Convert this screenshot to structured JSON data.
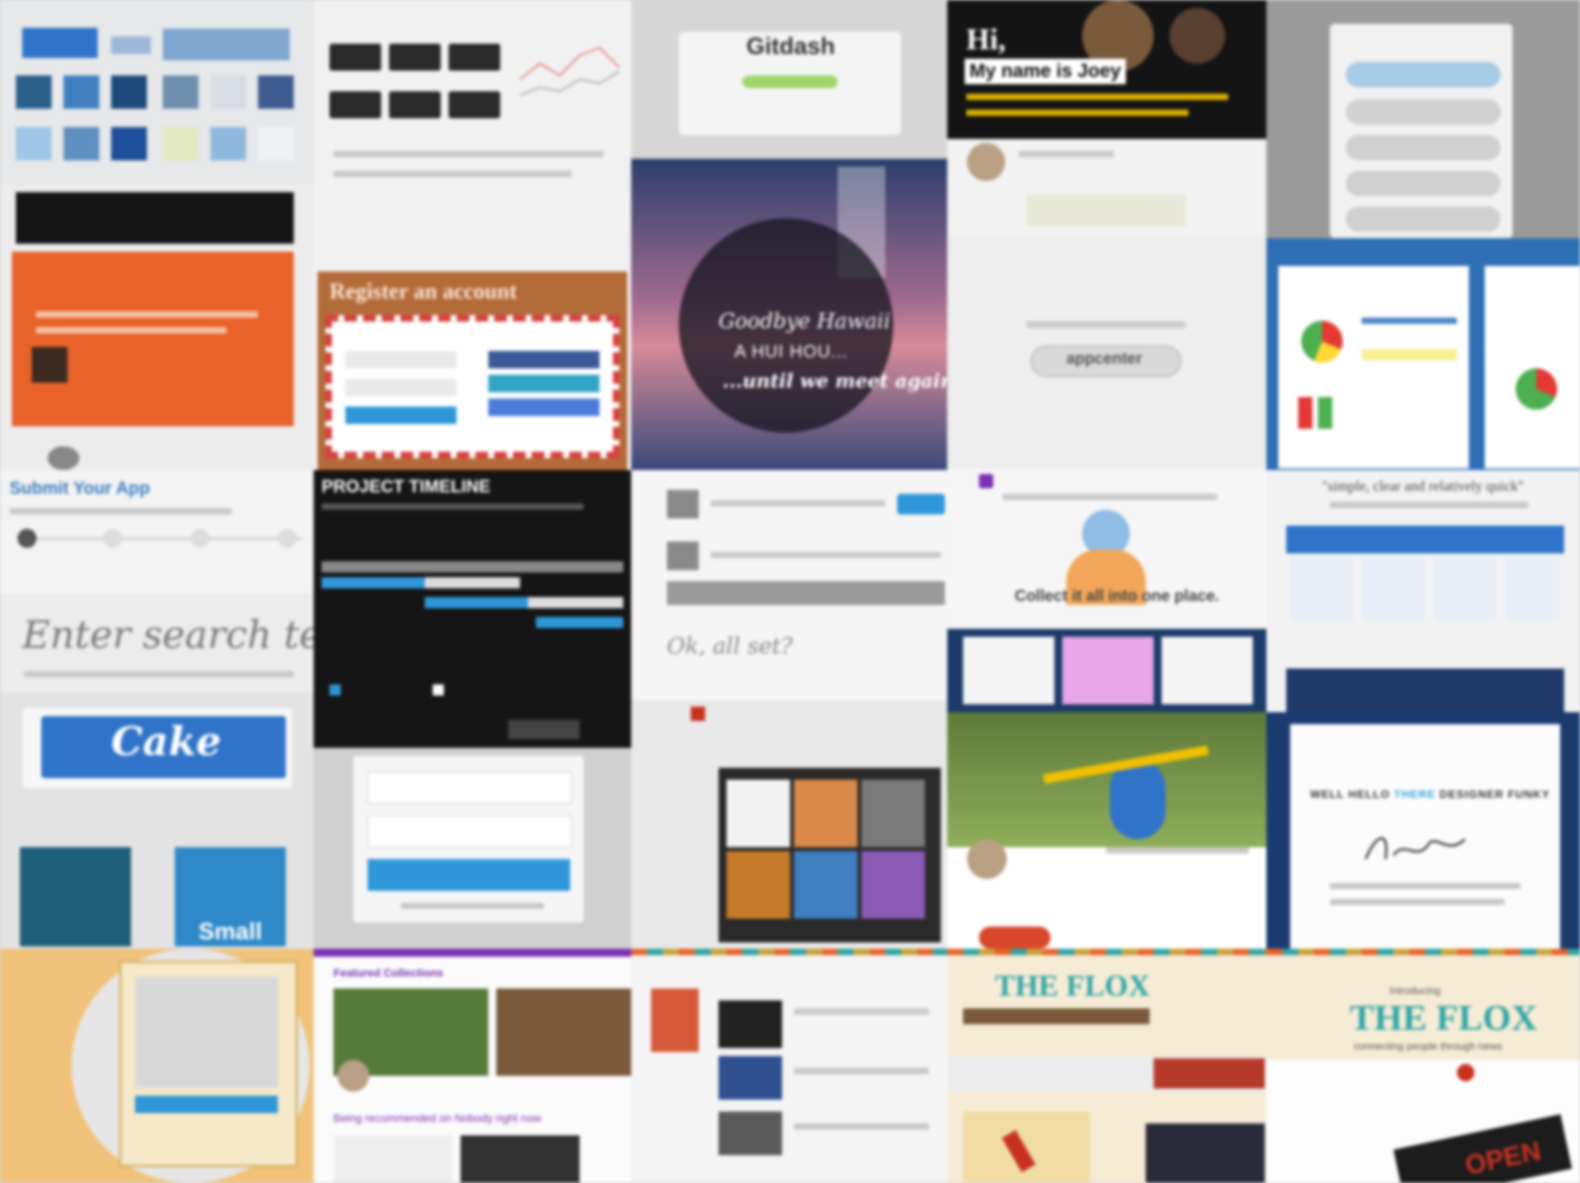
{
  "collage": {
    "gitdash": {
      "logo_text": "Gitdash"
    },
    "joey": {
      "greeting": "Hi,",
      "name_line": "My name is Joey"
    },
    "register": {
      "title": "Register an account"
    },
    "goodbye": {
      "line1": "Goodbye Hawaii",
      "line2": "A HUI HOU...",
      "line3": "...until we meet again"
    },
    "appcenter": {
      "button_label": "appcenter"
    },
    "submit_app": {
      "title": "Submit Your App"
    },
    "timeline": {
      "title": "PROJECT TIMELINE"
    },
    "collect": {
      "tagline": "Collect it all into one place."
    },
    "search": {
      "placeholder": "Enter search term"
    },
    "allset": {
      "heading": "Ok, all set?"
    },
    "cake": {
      "logo_text": "Cake",
      "small_label": "Small"
    },
    "simple": {
      "quote": "\"simple, clear and relatively quick\""
    },
    "designer": {
      "heading_pre": "WELL HELLO ",
      "heading_em": "THERE",
      "heading_post": " DESIGNER FUNKY"
    },
    "collections": {
      "title": "Featured Collections",
      "subtitle": "Being recommended on Nobody right now"
    },
    "flox": {
      "logo_text": "THE FLOX",
      "intro": "Introducing",
      "tagline": "connecting people through news",
      "sign": "OPEN"
    },
    "colors": {
      "orange": "#e8622a",
      "blue": "#2f74c8",
      "dark": "#1c1c1c",
      "teal": "#2fa4a4",
      "purple": "#7b2fb5",
      "red": "#c7321f",
      "gold": "#c8a23a"
    },
    "icons": [
      "fox-icon",
      "dog-icon",
      "pin-icon",
      "camera-icon"
    ]
  }
}
